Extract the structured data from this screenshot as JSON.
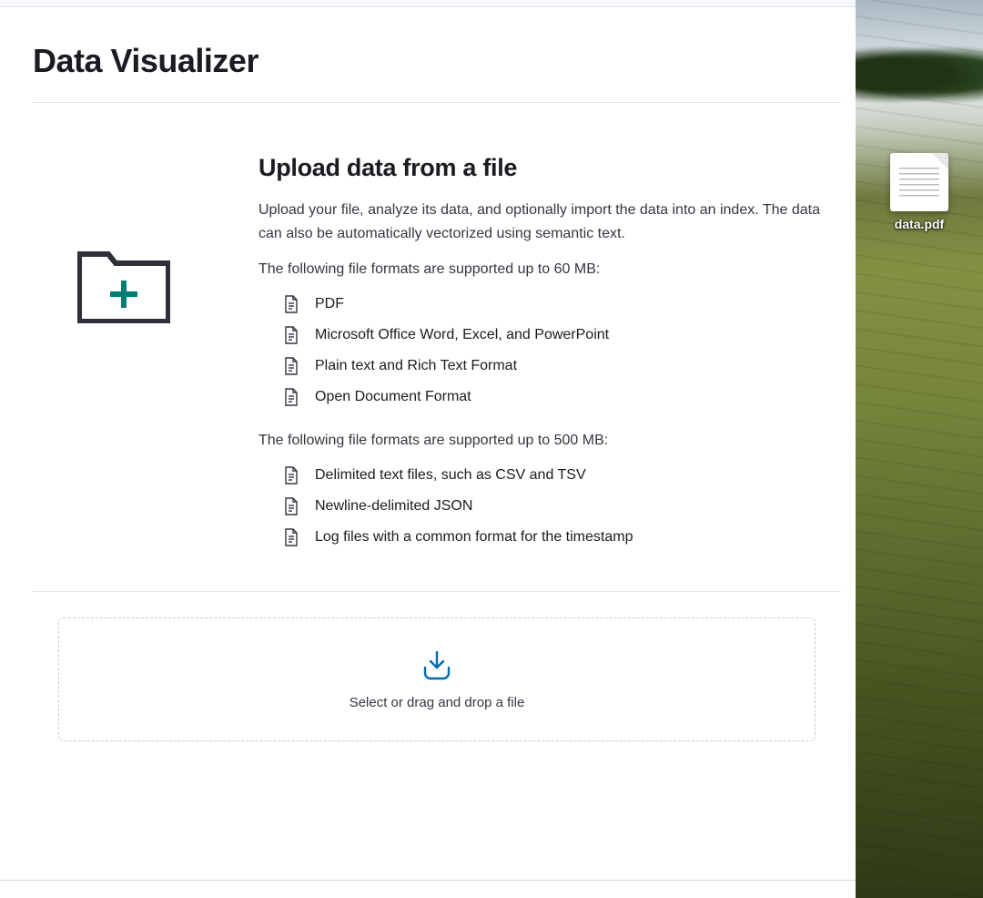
{
  "page": {
    "title": "Data Visualizer"
  },
  "hero": {
    "heading": "Upload data from a file",
    "description": "Upload your file, analyze its data, and optionally import the data into an index. The data can also be automatically vectorized using semantic text.",
    "small_limit_intro": "The following file formats are supported up to 60 MB:",
    "small_formats": [
      "PDF",
      "Microsoft Office Word, Excel, and PowerPoint",
      "Plain text and Rich Text Format",
      "Open Document Format"
    ],
    "large_limit_intro": "The following file formats are supported up to 500 MB:",
    "large_formats": [
      "Delimited text files, such as CSV and TSV",
      "Newline-delimited JSON",
      "Log files with a common format for the timestamp"
    ]
  },
  "dropzone": {
    "prompt": "Select or drag and drop a file"
  },
  "desktop": {
    "file_name": "data.pdf"
  }
}
